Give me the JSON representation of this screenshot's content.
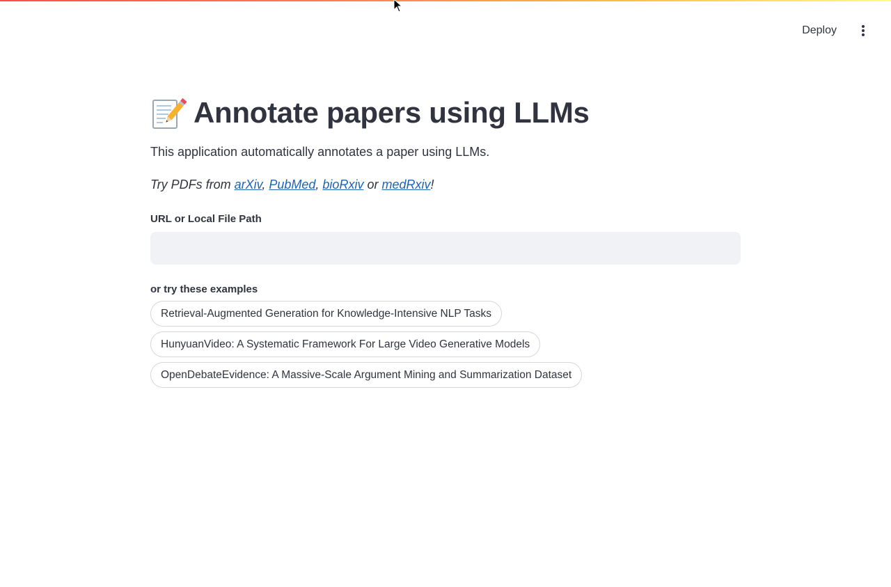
{
  "header": {
    "deploy_label": "Deploy",
    "menu_icon": "more-vertical-icon"
  },
  "page": {
    "title_icon": "memo-emoji-icon",
    "title": "Annotate papers using LLMs",
    "description": "This application automatically annotates a paper using LLMs.",
    "try_prefix": "Try PDFs from ",
    "sources": [
      "arXiv",
      "PubMed",
      "bioRxiv",
      "medRxiv"
    ],
    "sep_comma": ", ",
    "sep_or": " or ",
    "try_suffix": "!"
  },
  "url_field": {
    "label": "URL or Local File Path",
    "value": "",
    "placeholder": ""
  },
  "examples": {
    "label": "or try these examples",
    "items": [
      "Retrieval-Augmented Generation for Knowledge-Intensive NLP Tasks",
      "HunyuanVideo: A Systematic Framework For Large Video Generative Models",
      "OpenDebateEvidence: A Massive-Scale Argument Mining and Summarization Dataset"
    ]
  },
  "colors": {
    "accent": "#ff4b4b",
    "link": "#1c64b5",
    "text": "#31333f",
    "input_bg": "#f0f2f6"
  }
}
